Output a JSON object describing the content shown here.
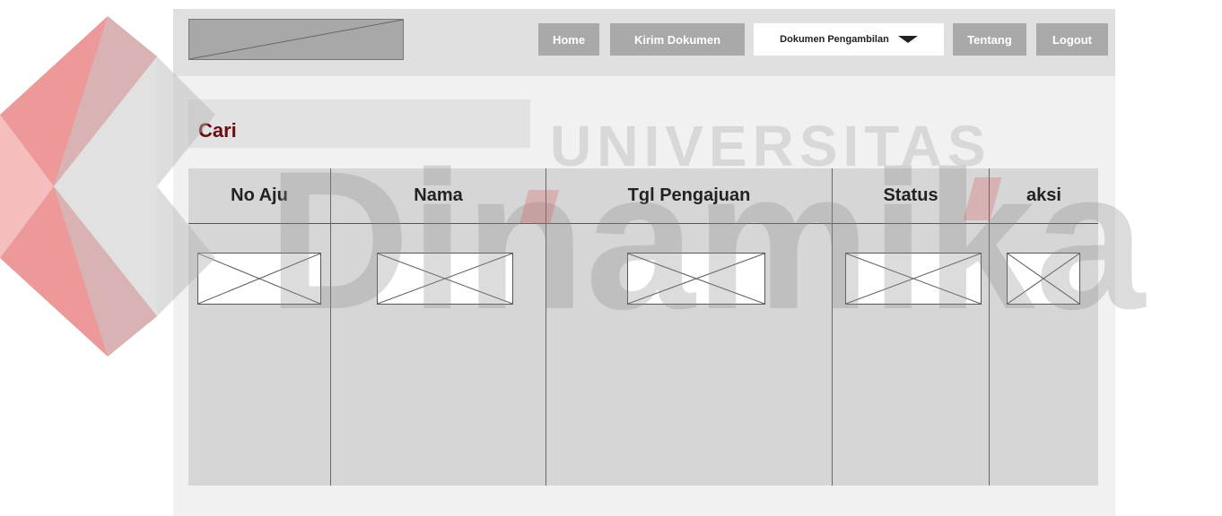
{
  "nav": {
    "home": "Home",
    "kirim": "Kirim Dokumen",
    "pengambilan": "Dokumen Pengambilan",
    "tentang": "Tentang",
    "logout": "Logout"
  },
  "search": {
    "label": "Cari"
  },
  "table": {
    "headers": [
      "No Aju",
      "Nama",
      "Tgl Pengajuan",
      "Status",
      "aksi"
    ]
  },
  "watermark": {
    "line1": "UNIVERSITAS",
    "line2": "Dinamika"
  },
  "colors": {
    "header_bg": "#e0e0e0",
    "button": "#a9a9a9",
    "accent_text": "#6b0e12",
    "watermark_red": "#e04646"
  }
}
